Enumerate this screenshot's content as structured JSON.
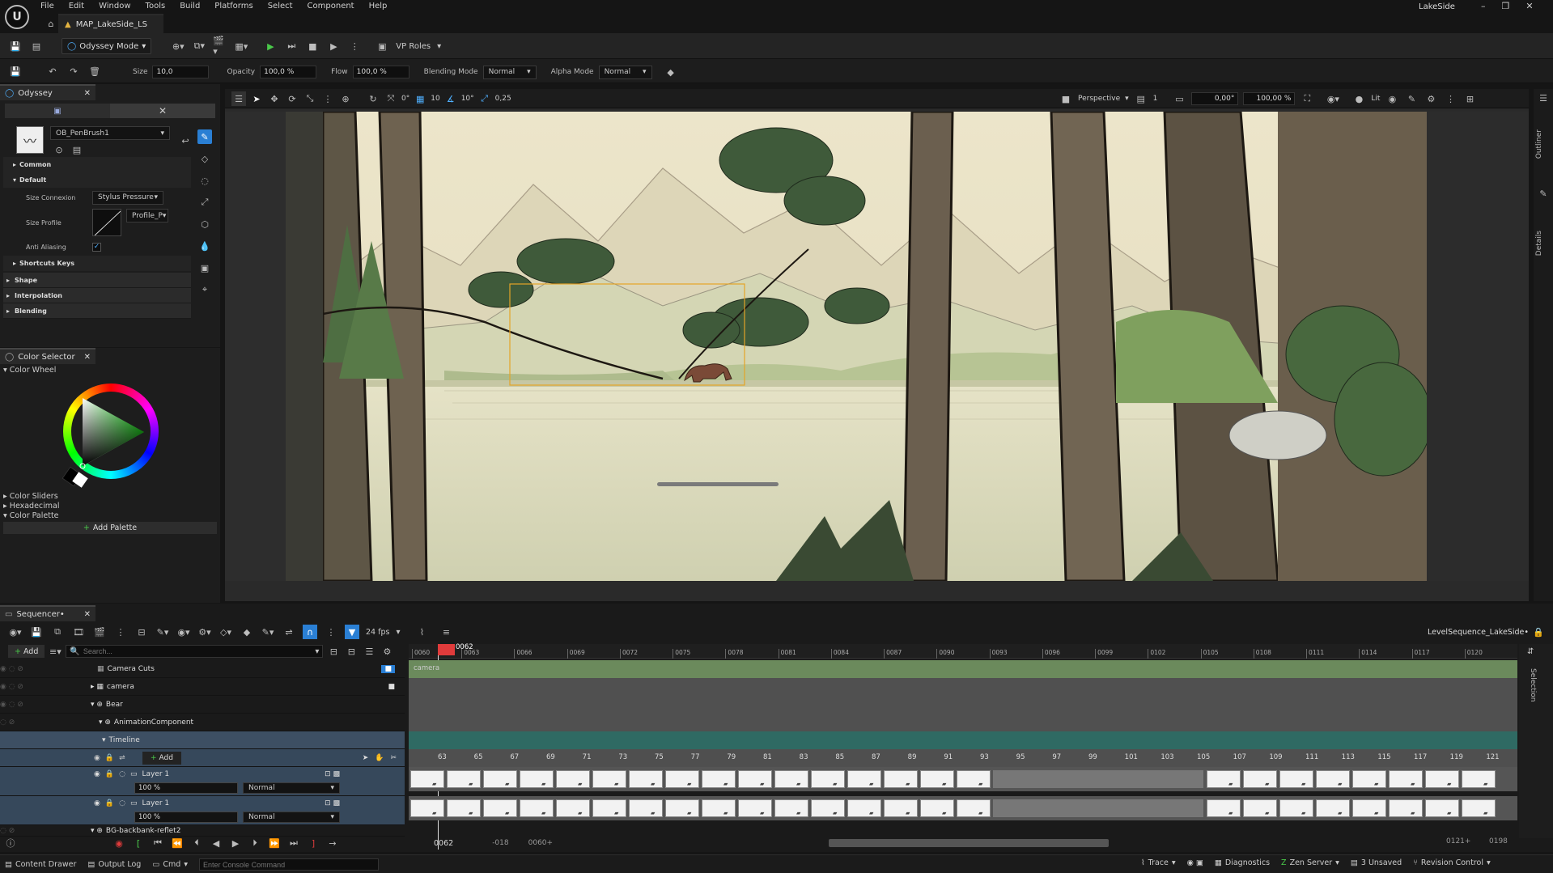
{
  "menu": [
    "File",
    "Edit",
    "Window",
    "Tools",
    "Build",
    "Platforms",
    "Select",
    "Component",
    "Help"
  ],
  "app_title": "LakeSide",
  "doc_tab": "MAP_LakeSide_LS",
  "toolbar": {
    "mode": "Odyssey Mode",
    "vp_roles": "VP Roles"
  },
  "brush_bar": {
    "size_label": "Size",
    "size_value": "10,0",
    "opacity_label": "Opacity",
    "opacity_value": "100,0 %",
    "flow_label": "Flow",
    "flow_value": "100,0 %",
    "blend_label": "Blending Mode",
    "blend_value": "Normal",
    "alpha_label": "Alpha Mode",
    "alpha_value": "Normal"
  },
  "odyssey": {
    "tab": "Odyssey",
    "brush_name": "OB_PenBrush1",
    "cat_common": "Common",
    "cat_default": "Default",
    "size_connexion_label": "Size Connexion",
    "size_connexion_value": "Stylus Pressure",
    "size_profile_label": "Size Profile",
    "size_profile_value": "Profile_P",
    "anti_aliasing_label": "Anti Aliasing",
    "cat_shortcuts": "Shortcuts Keys",
    "cat_shape": "Shape",
    "cat_interpolation": "Interpolation",
    "cat_blending": "Blending"
  },
  "color_selector": {
    "tab": "Color Selector",
    "wheel": "Color Wheel",
    "sliders": "Color Sliders",
    "hex": "Hexadecimal",
    "palette": "Color Palette",
    "add_palette": "Add Palette"
  },
  "viewport": {
    "snap_a": "0°",
    "grid": "10",
    "rot": "10°",
    "scale": "0,25",
    "perspective": "Perspective",
    "cam_speed": "1",
    "angle": "0,00°",
    "zoom": "100,00 %",
    "lit": "Lit"
  },
  "right_tabs": {
    "outliner": "Outliner",
    "details": "Details",
    "selection": "Selection"
  },
  "sequencer": {
    "tab": "Sequencer•",
    "fps": "24 fps",
    "sequence_name": "LevelSequence_LakeSide•",
    "add": "Add",
    "search_placeholder": "Search...",
    "current_frame": "0062",
    "ruler": [
      "0060",
      "0063",
      "0066",
      "0069",
      "0072",
      "0075",
      "0078",
      "0081",
      "0084",
      "0087",
      "0090",
      "0093",
      "0096",
      "0099",
      "0102",
      "0105",
      "0108",
      "0111",
      "0114",
      "0117",
      "0120"
    ],
    "frame_numbers": [
      "63",
      "65",
      "67",
      "69",
      "71",
      "73",
      "75",
      "77",
      "79",
      "81",
      "83",
      "85",
      "87",
      "89",
      "91",
      "93",
      "95",
      "97",
      "99",
      "101",
      "103",
      "105",
      "107",
      "109",
      "111",
      "113",
      "115",
      "117",
      "119",
      "121"
    ],
    "tracks": {
      "camera_cuts": "Camera Cuts",
      "camera": "camera",
      "bear": "Bear",
      "anim_comp": "AnimationComponent",
      "timeline": "Timeline",
      "timeline_add": "Add",
      "layer1": "Layer 1",
      "layer1_opacity": "100 %",
      "layer1_blend": "Normal",
      "layer2": "Layer 1",
      "layer2_opacity": "100 %",
      "layer2_blend": "Normal",
      "bg": "BG-backbank-reflet2"
    },
    "camera_section_label": "camera",
    "transport_frame": "0062",
    "range_start": "-018",
    "range_in": "0060+",
    "range_out": "0121+",
    "range_end": "0198"
  },
  "status": {
    "content_drawer": "Content Drawer",
    "output_log": "Output Log",
    "cmd": "Cmd",
    "console_placeholder": "Enter Console Command",
    "trace": "Trace",
    "diagnostics": "Diagnostics",
    "zen": "Zen Server",
    "unsaved": "3 Unsaved",
    "revision": "Revision Control"
  },
  "colors": {
    "accent": "#2a7fd4",
    "playhead": "#e03b3b",
    "camera_track": "#6b8a5c"
  }
}
